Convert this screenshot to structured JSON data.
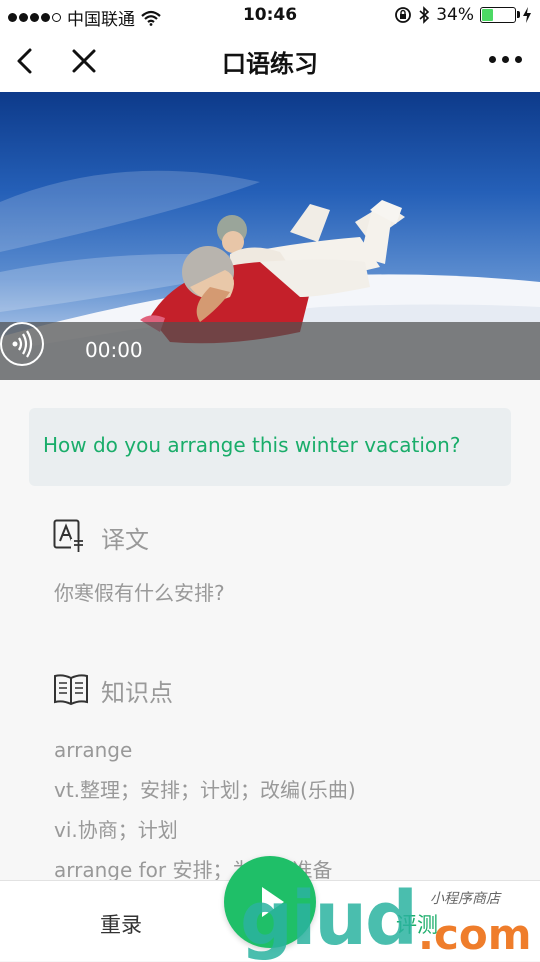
{
  "status_bar": {
    "carrier": "中国联通",
    "time": "10:46",
    "battery_percent": "34%",
    "battery_level": 0.34,
    "icons": [
      "signal-dots-icon",
      "wifi-icon",
      "rotation-lock-icon",
      "bluetooth-icon",
      "battery-icon",
      "charging-icon"
    ]
  },
  "nav": {
    "title": "口语练习",
    "icons": [
      "back-chevron-icon",
      "close-icon",
      "more-dots-icon"
    ]
  },
  "audio": {
    "time": "00:00",
    "icon": "audio-wave-icon"
  },
  "question": {
    "text": "How do you arrange this winter vacation?"
  },
  "translation": {
    "heading": "译文",
    "icon": "translate-icon",
    "text": "你寒假有什么安排?"
  },
  "knowledge": {
    "heading": "知识点",
    "icon": "book-icon",
    "lines": [
      "arrange",
      "vt.整理；安排；计划；改编(乐曲)",
      "vi.协商；计划",
      "arrange for 安排；为…做准备"
    ]
  },
  "bottom": {
    "rerecord_label": "重录",
    "assess_label": "评测",
    "play_icon": "play-icon"
  },
  "watermark": {
    "big_text": "giud",
    "suffix": ".com",
    "small_text": "小程序商店"
  },
  "colors": {
    "accent": "#1aad6a",
    "play_button": "#1fbf68",
    "question_bg": "#eaeef0"
  }
}
